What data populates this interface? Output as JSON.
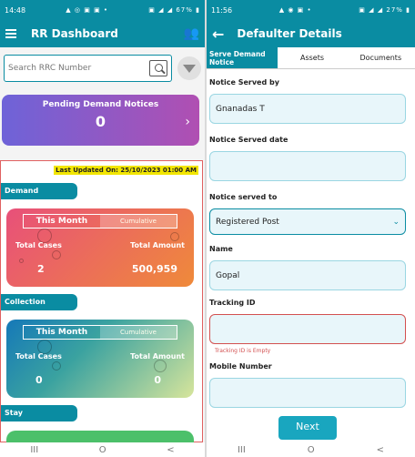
{
  "left_phone": {
    "status_time": "14:48",
    "status_battery": "67%",
    "title": "RR Dashboard",
    "search_placeholder": "Search RRC Number",
    "pending": {
      "title": "Pending Demand Notices",
      "value": "0"
    },
    "last_updated": "Last Updated On: 25/10/2023 01:00 AM",
    "sections": {
      "demand": {
        "label": "Demand",
        "tab_active": "This Month",
        "tab_inactive": "Cumulative",
        "total_cases_label": "Total Cases",
        "total_amount_label": "Total Amount",
        "total_cases": "2",
        "total_amount": "500,959"
      },
      "collection": {
        "label": "Collection",
        "tab_active": "This Month",
        "tab_inactive": "Cumulative",
        "total_cases_label": "Total Cases",
        "total_amount_label": "Total Amount",
        "total_cases": "0",
        "total_amount": "0"
      },
      "stay": {
        "label": "Stay"
      }
    }
  },
  "right_phone": {
    "status_time": "11:56",
    "status_battery": "27%",
    "title": "Defaulter Details",
    "tabs": [
      "Serve Demand Notice",
      "Assets",
      "Documents"
    ],
    "fields": {
      "served_by": {
        "label": "Notice Served by",
        "value": "Gnanadas T"
      },
      "served_date": {
        "label": "Notice Served date",
        "value": ""
      },
      "served_to": {
        "label": "Notice served to",
        "value": "Registered Post"
      },
      "name": {
        "label": "Name",
        "value": "Gopal"
      },
      "tracking": {
        "label": "Tracking ID",
        "value": "",
        "error": "Tracking ID is Empty"
      },
      "mobile": {
        "label": "Mobile Number",
        "value": ""
      }
    },
    "next_label": "Next"
  },
  "nav": {
    "recent": "III",
    "home": "O",
    "back": "<"
  },
  "colors": {
    "primary": "#0a8ca2",
    "error": "#d35050",
    "highlight": "#f2e600"
  }
}
